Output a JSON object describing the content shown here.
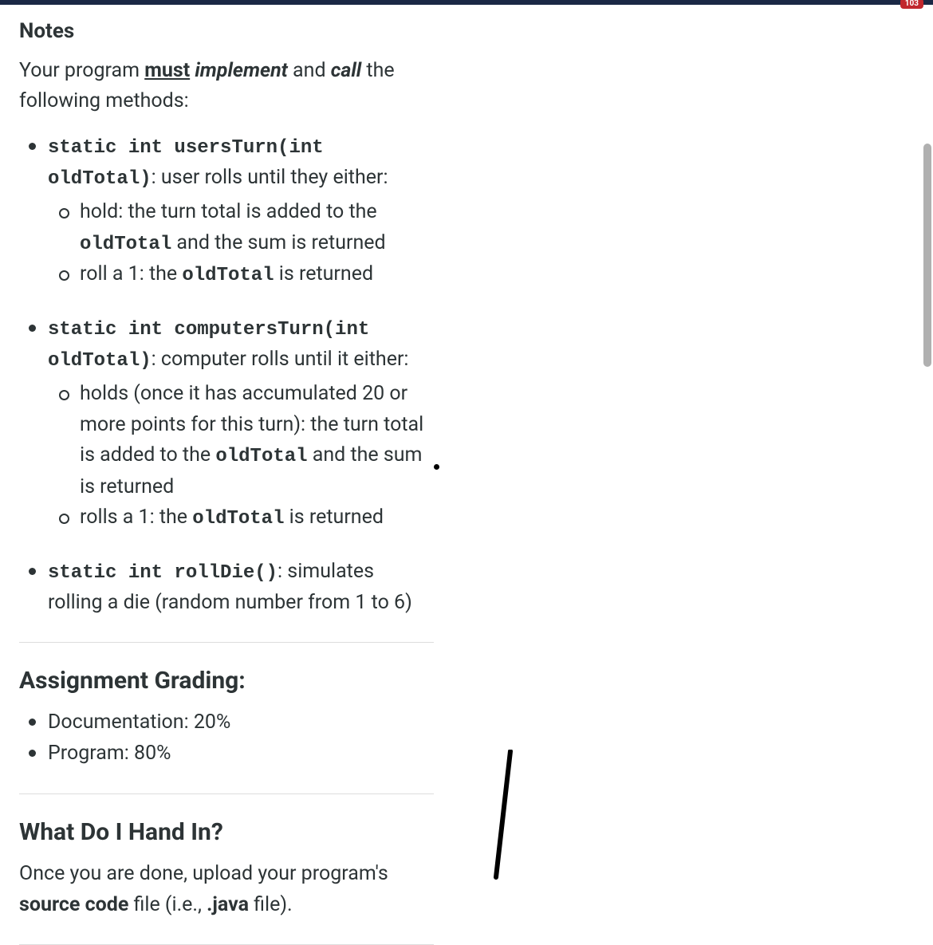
{
  "badge_text": "103",
  "notes": {
    "heading": "Notes",
    "intro_prefix": "Your program ",
    "intro_must": "must",
    "intro_space1": " ",
    "intro_implement": "implement",
    "intro_and": " and ",
    "intro_call": "call",
    "intro_suffix": " the following methods:"
  },
  "methods": {
    "m1_sig": "static int usersTurn(int oldTotal)",
    "m1_desc": ": user rolls until they either:",
    "m1_sub1_pre": "hold: the turn total is added to the ",
    "m1_sub1_code": "oldTotal",
    "m1_sub1_post": " and the sum is returned",
    "m1_sub2_pre": "roll a 1: the ",
    "m1_sub2_code": "oldTotal",
    "m1_sub2_post": " is returned",
    "m2_sig": "static int computersTurn(int oldTotal)",
    "m2_desc": ": computer rolls until it either:",
    "m2_sub1_pre": "holds (once it has accumulated 20 or more points for this turn): the turn total is added to the ",
    "m2_sub1_code": "oldTotal",
    "m2_sub1_post": " and the sum is returned",
    "m2_sub2_pre": "rolls a 1: the ",
    "m2_sub2_code": "oldTotal",
    "m2_sub2_post": " is returned",
    "m3_sig": "static int rollDie()",
    "m3_desc": ": simulates rolling a die (random number from 1 to 6)"
  },
  "grading": {
    "heading": "Assignment Grading:",
    "item1": "Documentation: 20%",
    "item2": "Program: 80%"
  },
  "handin": {
    "heading": "What Do I Hand In?",
    "text_pre": "Once you are done, upload your program's ",
    "text_bold1": "source code",
    "text_mid": " file (i.e., ",
    "text_bold2": ".java",
    "text_post": " file)."
  }
}
